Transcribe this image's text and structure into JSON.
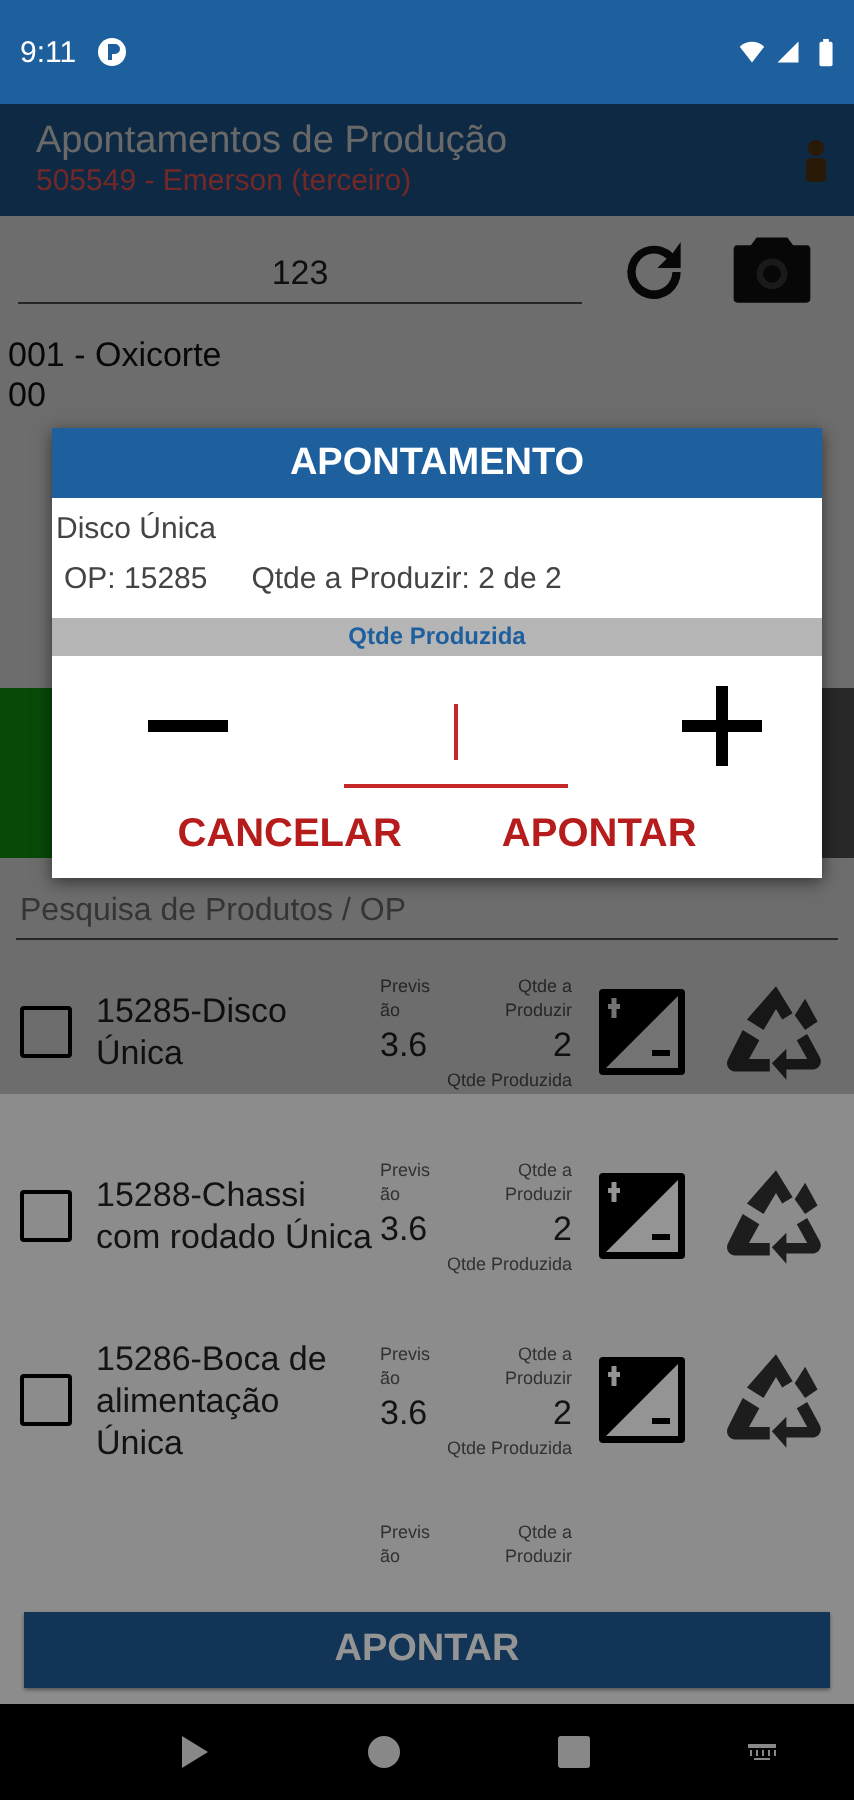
{
  "status_bar": {
    "time": "9:11"
  },
  "app_bar": {
    "title": "Apontamentos de Produção",
    "subtitle": "505549 - Emerson (terceiro)"
  },
  "scan": {
    "value": "123"
  },
  "operations": [
    "001 - Oxicorte",
    "00"
  ],
  "search": {
    "placeholder": "Pesquisa de Produtos / OP"
  },
  "items": [
    {
      "kind": "full",
      "name": "15285-Disco Única",
      "forecast_label": "Previsão",
      "forecast": "3.6",
      "to_produce_label": "Qtde a Produzir",
      "to_produce": "2",
      "produced_label": "Qtde Produzida",
      "checked": false
    },
    {
      "kind": "full",
      "name": "15288-Chassi com rodado Única",
      "forecast_label": "Previsão",
      "forecast": "3.6",
      "to_produce_label": "Qtde a Produzir",
      "to_produce": "2",
      "produced_label": "Qtde Produzida",
      "checked": false
    },
    {
      "kind": "full",
      "name": "15286-Boca de alimentação Única",
      "forecast_label": "Previsão",
      "forecast": "3.6",
      "to_produce_label": "Qtde a Produzir",
      "to_produce": "2",
      "produced_label": "Qtde Produzida",
      "checked": false
    },
    {
      "kind": "partial",
      "forecast_label": "Previsão",
      "to_produce_label": "Qtde a Produzir"
    }
  ],
  "footer_button": "APONTAR",
  "dialog": {
    "title": "APONTAMENTO",
    "product": "Disco Única",
    "op": "OP: 15285",
    "quantity": "Qtde a Produzir: 2 de 2",
    "section": "Qtde Produzida",
    "buttons": [
      "CANCELAR",
      "APONTAR"
    ]
  }
}
